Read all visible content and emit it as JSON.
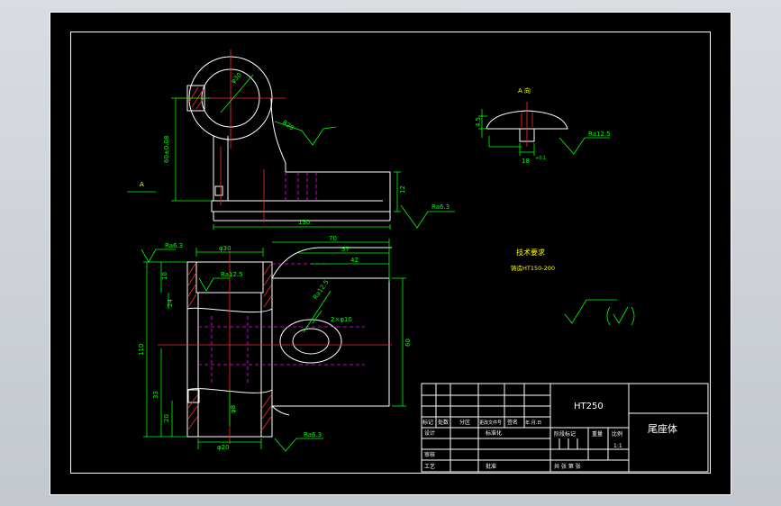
{
  "colors": {
    "background": "#000000",
    "frame": "#ffffff",
    "outline": "#ffffff",
    "dimension": "#00ff00",
    "center_line": "#ff2a2a",
    "hidden_line": "#ff00ff",
    "note_text": "#ffff00",
    "hatch": "#ff2a2a"
  },
  "views": {
    "front": {
      "dims": {
        "diameter": "φ30",
        "height": "60±0.08",
        "length": "130",
        "thickness": "12",
        "radius": "R28"
      },
      "section_label": "A",
      "roughness": "Ra6.3"
    },
    "detail": {
      "title": "A 向",
      "dims": {
        "height": "4.5",
        "width": "18",
        "tol": "+0.1"
      },
      "roughness": "Ra12.5"
    },
    "side": {
      "dims": {
        "top_width": "φ30",
        "overall": "70",
        "d1": "57",
        "d2": "42",
        "left_height": "110",
        "h1": "10",
        "h2": "24",
        "h3": "33",
        "h4": "20",
        "right_height": "60",
        "bottom": "φ20",
        "small": "φ8",
        "chamfer": "2×φ10"
      },
      "roughness_top": "Ra6.3",
      "roughness_inner": "Ra12.5",
      "roughness_bottom": "Ra6.3",
      "roughness_right": "Ra12.5"
    }
  },
  "notes": {
    "title": "技术要求",
    "line1": "铸造HT150-200"
  },
  "title_block": {
    "material": "HT250",
    "part_name": "尾座体",
    "labels": {
      "mark": "标记",
      "count": "处数",
      "zone": "分区",
      "doc_no": "更改文件号",
      "sign": "签名",
      "date": "年.月.日",
      "design": "设计",
      "standard": "标准化",
      "review": "审核",
      "process": "工艺",
      "approve": "批准",
      "stage_mark": "阶段标记",
      "weight": "重量",
      "scale": "比例",
      "sheet_count": "共 张 第 张",
      "scale_value": "1:1"
    }
  }
}
